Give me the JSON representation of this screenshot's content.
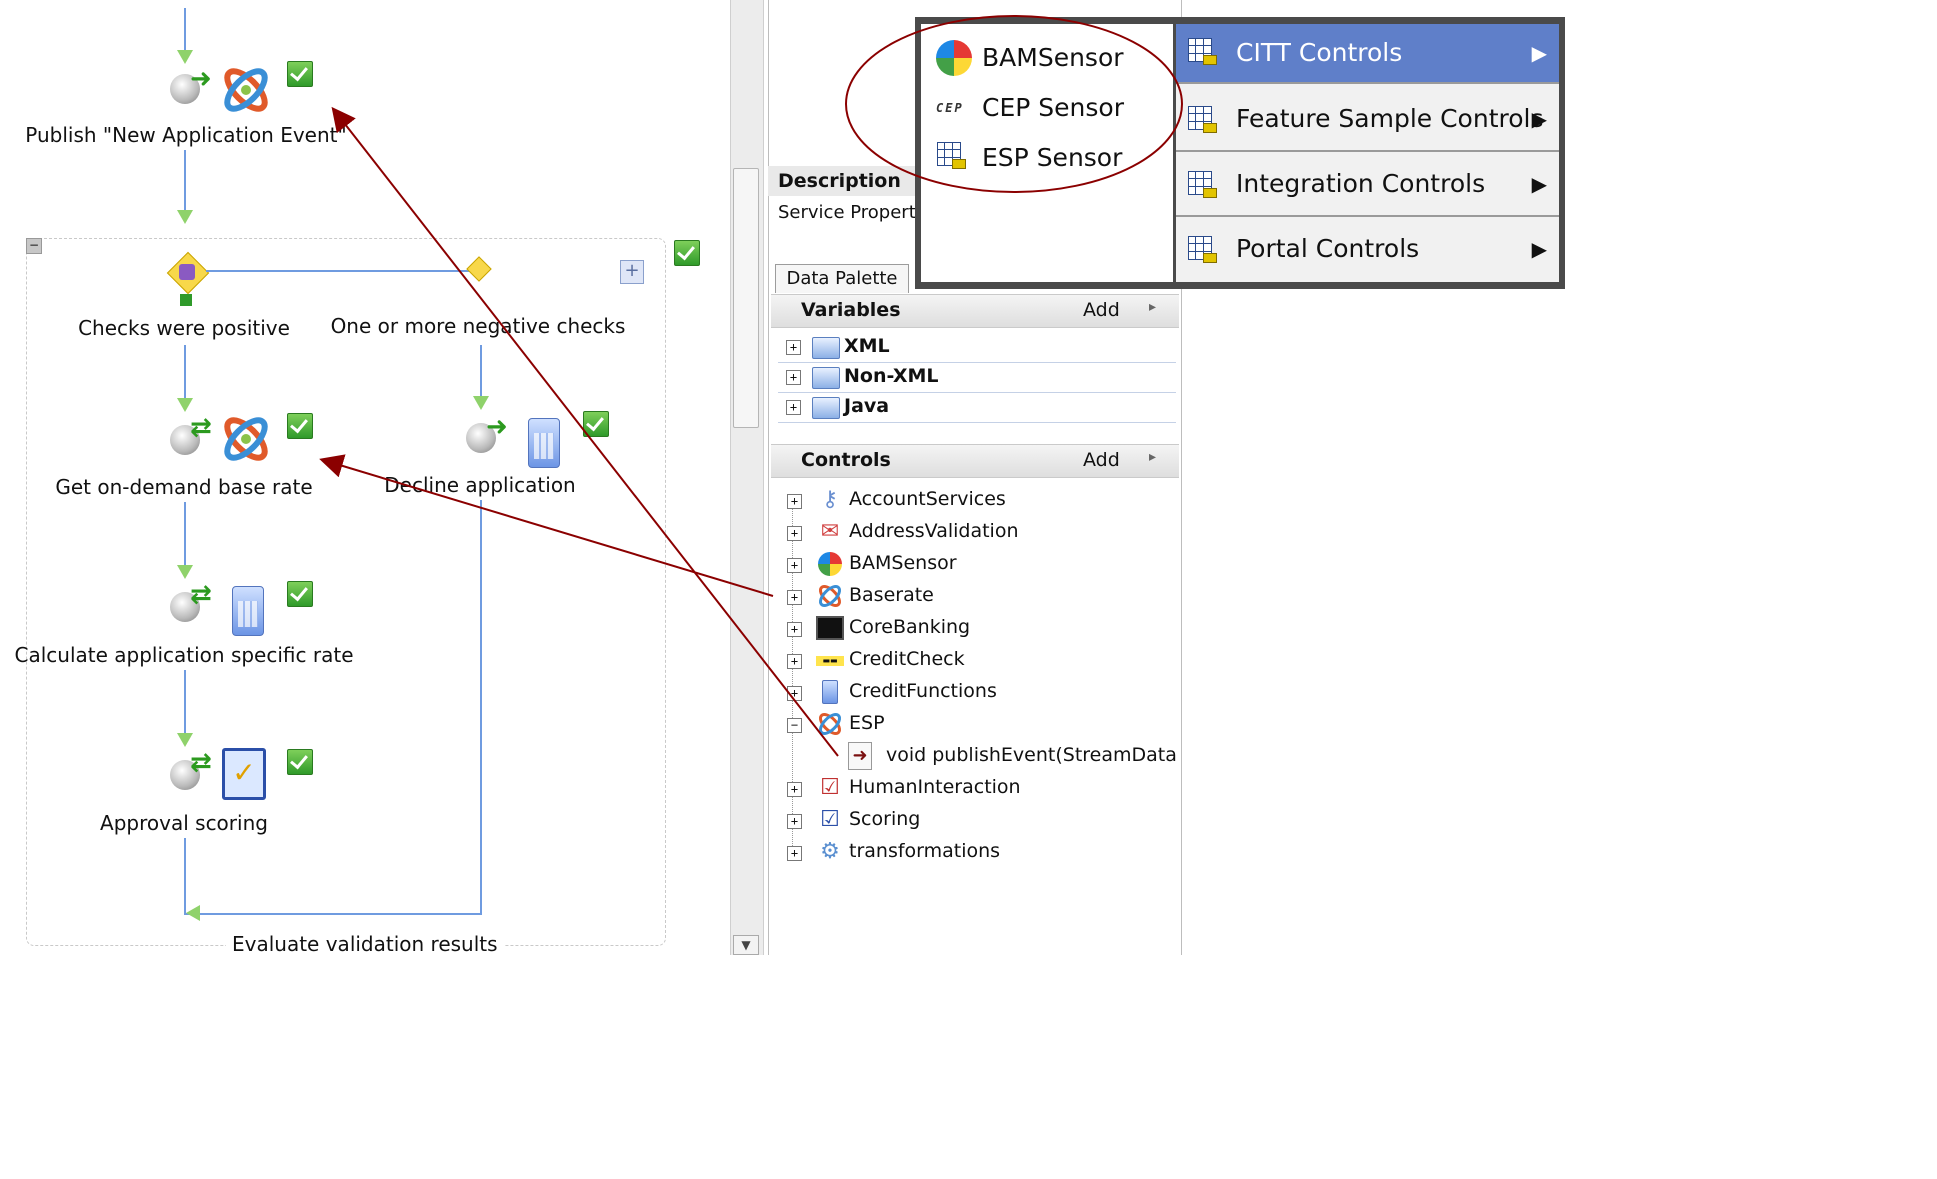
{
  "flow": {
    "nodes": [
      {
        "label": "Publish \"New Application Event\""
      },
      {
        "label": "Checks were positive"
      },
      {
        "label": "One or more negative checks"
      },
      {
        "label": "Get on-demand base rate"
      },
      {
        "label": "Decline application"
      },
      {
        "label": "Calculate application specific rate"
      },
      {
        "label": "Approval scoring"
      },
      {
        "label": "Evaluate validation results"
      }
    ]
  },
  "properties": {
    "description_header": "Description",
    "description_text": "Service Properti"
  },
  "palette": {
    "tab_label": "Data Palette",
    "variables": {
      "title": "Variables",
      "add_label": "Add",
      "items": [
        {
          "label": "XML"
        },
        {
          "label": "Non-XML"
        },
        {
          "label": "Java"
        }
      ]
    },
    "controls": {
      "title": "Controls",
      "add_label": "Add",
      "items": [
        {
          "label": "AccountServices",
          "icon": "key-icon"
        },
        {
          "label": "AddressValidation",
          "icon": "envelope-icon"
        },
        {
          "label": "BAMSensor",
          "icon": "pie-icon"
        },
        {
          "label": "Baserate",
          "icon": "esp-logo-icon"
        },
        {
          "label": "CoreBanking",
          "icon": "monitor-icon"
        },
        {
          "label": "CreditCheck",
          "icon": "schufa-icon"
        },
        {
          "label": "CreditFunctions",
          "icon": "calculator-icon"
        },
        {
          "label": "ESP",
          "icon": "esp-logo-icon"
        },
        {
          "label": "void publishEvent(StreamDataDoc",
          "icon": "method-icon"
        },
        {
          "label": "HumanInteraction",
          "icon": "human-icon"
        },
        {
          "label": "Scoring",
          "icon": "scoring-icon"
        },
        {
          "label": "transformations",
          "icon": "transform-icon"
        }
      ]
    }
  },
  "menu": {
    "left_items": [
      {
        "label": "BAMSensor",
        "icon": "pie-icon"
      },
      {
        "label": "CEP Sensor",
        "icon": "cep-icon",
        "icon_text": "CEP"
      },
      {
        "label": "ESP Sensor",
        "icon": "control-grid-icon"
      }
    ],
    "right_items": [
      {
        "label": "CITT Controls",
        "selected": true
      },
      {
        "label": "Feature Sample Controls",
        "selected": false
      },
      {
        "label": "Integration Controls",
        "selected": false
      },
      {
        "label": "Portal Controls",
        "selected": false
      }
    ],
    "submenu_arrow": "▶"
  },
  "colors": {
    "annotation": "#8b0000",
    "menu_highlight": "#5f7fc9",
    "flow_line": "#6f9be0",
    "check_green": "#2f9a2a"
  }
}
